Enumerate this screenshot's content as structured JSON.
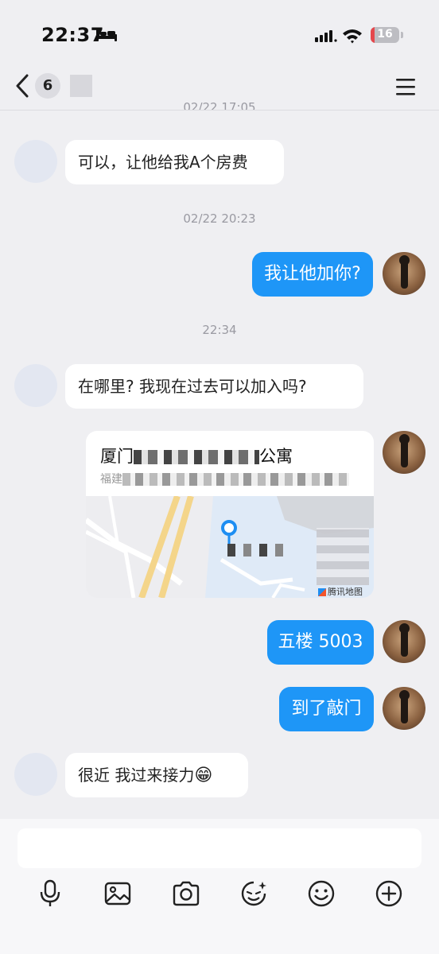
{
  "status_bar": {
    "time": "22:37",
    "battery_level": "16",
    "battery_color": "#e5484d"
  },
  "nav": {
    "unread_count": "6",
    "back_icon": "chevron-left-icon",
    "menu_icon": "hamburger-menu-icon",
    "clipped_timestamp": "02/22 17:05"
  },
  "messages": [
    {
      "side": "in",
      "text": "可以，让他给我A个房费"
    },
    {
      "type": "timestamp",
      "text": "02/22 20:23"
    },
    {
      "side": "out",
      "text": "我让他加你?"
    },
    {
      "type": "timestamp",
      "text": "22:34"
    },
    {
      "side": "in",
      "text": "在哪里? 我现在过去可以加入吗?"
    },
    {
      "side": "out",
      "type": "location",
      "title": "厦门",
      "title_suffix": "公寓",
      "address_prefix": "福建",
      "map_brand": "腾讯地图"
    },
    {
      "side": "out",
      "text": "五楼 5003"
    },
    {
      "side": "out",
      "text": "到了敲门"
    },
    {
      "side": "in",
      "text": "很近 我过来接力",
      "emoji": "😁"
    }
  ],
  "input": {
    "placeholder": ""
  },
  "toolbar": [
    {
      "icon": "microphone-icon"
    },
    {
      "icon": "image-icon"
    },
    {
      "icon": "camera-icon"
    },
    {
      "icon": "sticker-icon"
    },
    {
      "icon": "emoji-icon"
    },
    {
      "icon": "plus-icon"
    }
  ],
  "colors": {
    "outgoing_bubble": "#1e96f7",
    "incoming_bubble": "#ffffff",
    "background": "#efeff2"
  }
}
